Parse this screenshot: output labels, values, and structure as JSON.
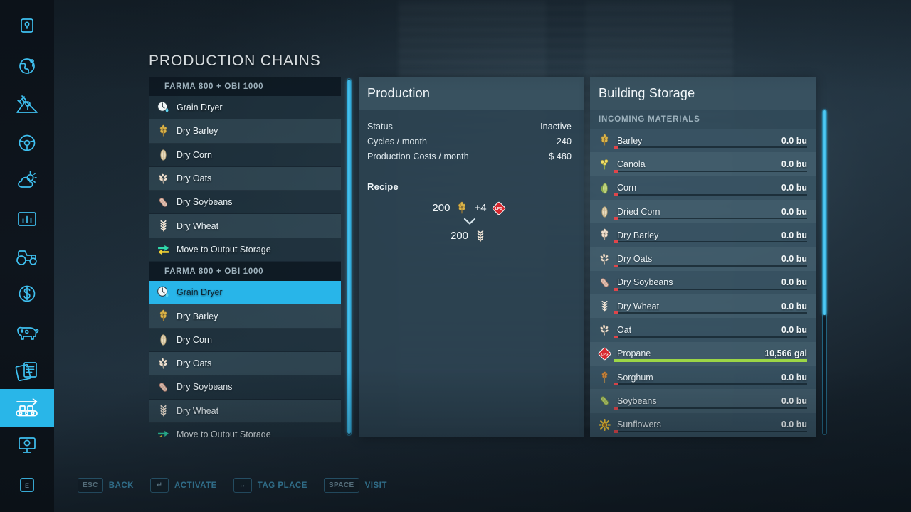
{
  "page": {
    "title": "PRODUCTION CHAINS",
    "accent": "#29b6e8",
    "panel_bg": "#2c4351",
    "selected_row_bg": "#28b5e9",
    "bar_empty_color": "#e0454a",
    "bar_full_color": "#9cd646"
  },
  "sidebar": {
    "items": [
      {
        "name": "map-marker-icon",
        "icon": "marker-box",
        "active": false
      },
      {
        "name": "globe-icon",
        "icon": "globe",
        "active": false
      },
      {
        "name": "satellite-map-icon",
        "icon": "satellite",
        "active": false
      },
      {
        "name": "steering-wheel-icon",
        "icon": "steering",
        "active": false
      },
      {
        "name": "weather-icon",
        "icon": "weather",
        "active": false
      },
      {
        "name": "statistics-icon",
        "icon": "stats",
        "active": false
      },
      {
        "name": "vehicles-icon",
        "icon": "tractor",
        "active": false
      },
      {
        "name": "finances-icon",
        "icon": "dollar",
        "active": false
      },
      {
        "name": "animals-icon",
        "icon": "cow",
        "active": false
      },
      {
        "name": "contracts-icon",
        "icon": "documents",
        "active": false
      },
      {
        "name": "production-icon",
        "icon": "conveyor",
        "active": true
      },
      {
        "name": "construction-icon",
        "icon": "screen",
        "active": false
      },
      {
        "name": "help-key-icon",
        "icon": "key-e",
        "active": false
      }
    ]
  },
  "chain_list": {
    "rows": [
      {
        "type": "group",
        "label": "FARMA 800 + OBI 1000"
      },
      {
        "type": "item",
        "label": "Grain Dryer",
        "icon": "grain-dryer",
        "selected": false
      },
      {
        "type": "item",
        "label": "Dry Barley",
        "icon": "barley",
        "selected": false
      },
      {
        "type": "item",
        "label": "Dry Corn",
        "icon": "dried-corn",
        "selected": false
      },
      {
        "type": "item",
        "label": "Dry Oats",
        "icon": "oat",
        "selected": false
      },
      {
        "type": "item",
        "label": "Dry Soybeans",
        "icon": "soybeans",
        "selected": false
      },
      {
        "type": "item",
        "label": "Dry Wheat",
        "icon": "wheat",
        "selected": false
      },
      {
        "type": "item",
        "label": "Move to Output Storage",
        "icon": "move-arrows",
        "selected": false
      },
      {
        "type": "group",
        "label": "FARMA 800 + OBI 1000"
      },
      {
        "type": "item",
        "label": "Grain Dryer",
        "icon": "grain-dryer",
        "selected": true
      },
      {
        "type": "item",
        "label": "Dry Barley",
        "icon": "barley",
        "selected": false
      },
      {
        "type": "item",
        "label": "Dry Corn",
        "icon": "dried-corn",
        "selected": false
      },
      {
        "type": "item",
        "label": "Dry Oats",
        "icon": "oat",
        "selected": false
      },
      {
        "type": "item",
        "label": "Dry Soybeans",
        "icon": "soybeans",
        "selected": false
      },
      {
        "type": "item",
        "label": "Dry Wheat",
        "icon": "wheat",
        "selected": false
      },
      {
        "type": "item",
        "label": "Move to Output Storage",
        "icon": "move-arrows",
        "selected": false
      }
    ]
  },
  "production": {
    "title": "Production",
    "stats": [
      {
        "label": "Status",
        "value": "Inactive"
      },
      {
        "label": "Cycles / month",
        "value": "240"
      },
      {
        "label": "Production Costs / month",
        "value": "$ 480"
      }
    ],
    "recipe_title": "Recipe",
    "recipe": {
      "inputs": [
        {
          "amount": "200",
          "icon": "wheat-gold"
        },
        {
          "amount": "+4",
          "icon": "propane"
        }
      ],
      "arrow": "chevron-down",
      "outputs": [
        {
          "amount": "200",
          "icon": "dry-wheat"
        }
      ]
    }
  },
  "storage": {
    "title": "Building Storage",
    "section_label": "INCOMING MATERIALS",
    "items": [
      {
        "label": "Barley",
        "value": "0.0 bu",
        "icon": "barley",
        "fill": "empty"
      },
      {
        "label": "Canola",
        "value": "0.0 bu",
        "icon": "canola",
        "fill": "empty"
      },
      {
        "label": "Corn",
        "value": "0.0 bu",
        "icon": "corn",
        "fill": "empty"
      },
      {
        "label": "Dried Corn",
        "value": "0.0 bu",
        "icon": "dried-corn",
        "fill": "empty"
      },
      {
        "label": "Dry Barley",
        "value": "0.0 bu",
        "icon": "dry-barley",
        "fill": "empty"
      },
      {
        "label": "Dry Oats",
        "value": "0.0 bu",
        "icon": "dry-oats",
        "fill": "empty"
      },
      {
        "label": "Dry Soybeans",
        "value": "0.0 bu",
        "icon": "soybeans",
        "fill": "empty"
      },
      {
        "label": "Dry Wheat",
        "value": "0.0 bu",
        "icon": "dry-wheat",
        "fill": "empty"
      },
      {
        "label": "Oat",
        "value": "0.0 bu",
        "icon": "oat",
        "fill": "empty"
      },
      {
        "label": "Propane",
        "value": "10,566 gal",
        "icon": "propane",
        "fill": "full"
      },
      {
        "label": "Sorghum",
        "value": "0.0 bu",
        "icon": "sorghum",
        "fill": "empty"
      },
      {
        "label": "Soybeans",
        "value": "0.0 bu",
        "icon": "soybeans-g",
        "fill": "empty"
      },
      {
        "label": "Sunflowers",
        "value": "0.0 bu",
        "icon": "sunflower",
        "fill": "empty"
      }
    ]
  },
  "help_bar": {
    "actions": [
      {
        "key": "ESC",
        "label": "BACK"
      },
      {
        "key": "↵",
        "label": "ACTIVATE"
      },
      {
        "key": "↔",
        "label": "TAG PLACE"
      },
      {
        "key": "SPACE",
        "label": "VISIT"
      }
    ]
  }
}
